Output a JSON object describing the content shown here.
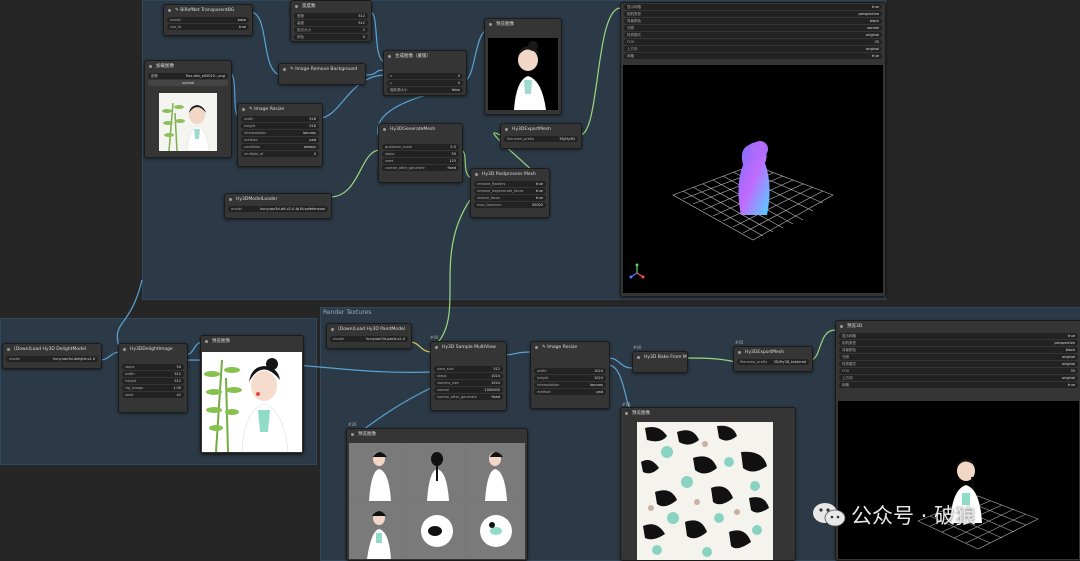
{
  "groups": {
    "top": {
      "title": ""
    },
    "bottom": {
      "title": "Render Textures"
    }
  },
  "nodes": {
    "transparent": {
      "title": "✎ BiRefNet TransparentBG",
      "w": [
        [
          "model",
          "base"
        ],
        [
          "use_fp",
          "true"
        ]
      ]
    },
    "loadimg": {
      "title": "加载图像",
      "w": [
        [
          "图像",
          "flux-dev_e00025...png"
        ]
      ],
      "btn": "upload"
    },
    "resize1": {
      "title": "✎ Image Resize",
      "w": [
        [
          "width",
          "518"
        ],
        [
          "height",
          "518"
        ],
        [
          "interpolation",
          "lanczos"
        ],
        [
          "method",
          "pad"
        ],
        [
          "condition",
          "always"
        ],
        [
          "multiple_of",
          "0"
        ]
      ]
    },
    "removebg": {
      "title": "✎ Image Remove Background"
    },
    "param": {
      "title": "宽度数",
      "w": [
        [
          "宽度",
          "512"
        ],
        [
          "高度",
          "512"
        ],
        [
          "批次大小",
          "1"
        ],
        [
          "颜色",
          "0"
        ]
      ]
    },
    "composite": {
      "title": "合成图像（蒙版）",
      "w": [
        [
          "x",
          "0"
        ],
        [
          "y",
          "0"
        ],
        [
          "缩放源大小",
          "false"
        ]
      ]
    },
    "preview1": {
      "title": "预览图像"
    },
    "gen": {
      "title": "Hy3DGenerateMesh",
      "w": [
        [
          "guidance_scale",
          "5.5"
        ],
        [
          "steps",
          "50"
        ],
        [
          "seed",
          "123"
        ],
        [
          "control_after_generate",
          "fixed"
        ],
        [
          "octree_resolution",
          "256"
        ]
      ]
    },
    "loadmodel": {
      "title": "Hy3DModelLoader",
      "w": [
        [
          "model",
          "hunyuan3d-dit-v2-0-fp16.safetensors"
        ]
      ]
    },
    "postproc": {
      "title": "Hy3D Postprocess Mesh",
      "w": [
        [
          "remove_floaters",
          "true"
        ],
        [
          "remove_degenerate_faces",
          "true"
        ],
        [
          "reduce_faces",
          "true"
        ],
        [
          "max_facenum",
          "50000"
        ]
      ]
    },
    "export": {
      "title": "Hy3DExportMesh",
      "w": [
        [
          "filename_prefix",
          "3D/Hy3D"
        ]
      ]
    },
    "preview3d": {
      "title": "预览3D",
      "w": [
        [
          "显示网格",
          "true"
        ],
        [
          "相机类型",
          "perspective"
        ],
        [
          "背景颜色",
          "black"
        ],
        [
          "光照",
          "normal"
        ],
        [
          "材质模式",
          "original"
        ],
        [
          "FOV",
          "35"
        ],
        [
          "上方向",
          "original"
        ],
        [
          "网格",
          "true"
        ]
      ]
    },
    "delight": {
      "title": "(Down)Load Hy3D DelightModel",
      "w": [
        [
          "model",
          "hunyuan3d-delight-v2-0"
        ]
      ]
    },
    "delightimg": {
      "title": "Hy3DDelightImage",
      "w": [
        [
          "steps",
          "50"
        ],
        [
          "width",
          "512"
        ],
        [
          "height",
          "512"
        ],
        [
          "cfg_image",
          "1.00"
        ],
        [
          "cfg_image2",
          "1.00"
        ],
        [
          "seed",
          "42"
        ],
        [
          "control_after_generate",
          "fixed"
        ]
      ]
    },
    "preview2": {
      "title": "预览图像"
    },
    "paint": {
      "title": "(Down)Load Hy3D PaintModel",
      "w": [
        [
          "model",
          "hunyuan3d-paint-v2-0"
        ]
      ]
    },
    "multiview": {
      "title": "Hy3D Sample MultiView",
      "w": [
        [
          "view_size",
          "512"
        ],
        [
          "steps",
          "1024"
        ],
        [
          "camera_size",
          "1024"
        ],
        [
          "seed",
          "60"
        ],
        [
          "denoise",
          "1024"
        ],
        [
          "control",
          "1000000"
        ],
        [
          "control_after_generate",
          "fixed"
        ]
      ]
    },
    "resize2": {
      "title": "✎ Image Resize",
      "w": [
        [
          "width",
          "1024"
        ],
        [
          "height",
          "1024"
        ],
        [
          "interpolation",
          "lanczos"
        ],
        [
          "method",
          "pad"
        ],
        [
          "condition",
          "always"
        ],
        [
          "multiple_of",
          "0"
        ]
      ]
    },
    "bakeview": {
      "title": "Hy3D Bake From Multiview"
    },
    "export2": {
      "title": "Hy3DExportMesh",
      "w": [
        [
          "filename_prefix",
          "3D/Hy3D_textured"
        ]
      ]
    },
    "preview4": {
      "title": "预览图像"
    },
    "preview5": {
      "title": "预览图像"
    },
    "preview3d2": {
      "title": "预览3D",
      "w": [
        [
          "显示网格",
          "true"
        ],
        [
          "相机类型",
          "perspective"
        ],
        [
          "背景颜色",
          "black"
        ],
        [
          "光照",
          "original"
        ],
        [
          "材质模式",
          "original"
        ],
        [
          "FOV",
          "35"
        ],
        [
          "上方向",
          "original"
        ],
        [
          "网格",
          "true"
        ]
      ]
    }
  },
  "badges": {
    "b1": "#40",
    "b2": "#40",
    "b3": "#45",
    "b4": "#26",
    "b5": "#18"
  },
  "watermark": {
    "text": "公众号 · 破狼"
  },
  "colors": {
    "wire_blue": "#5aa3d6",
    "wire_green": "#9bd77f",
    "wire_yellow": "#d7c85a",
    "group": "#2c3a47"
  }
}
